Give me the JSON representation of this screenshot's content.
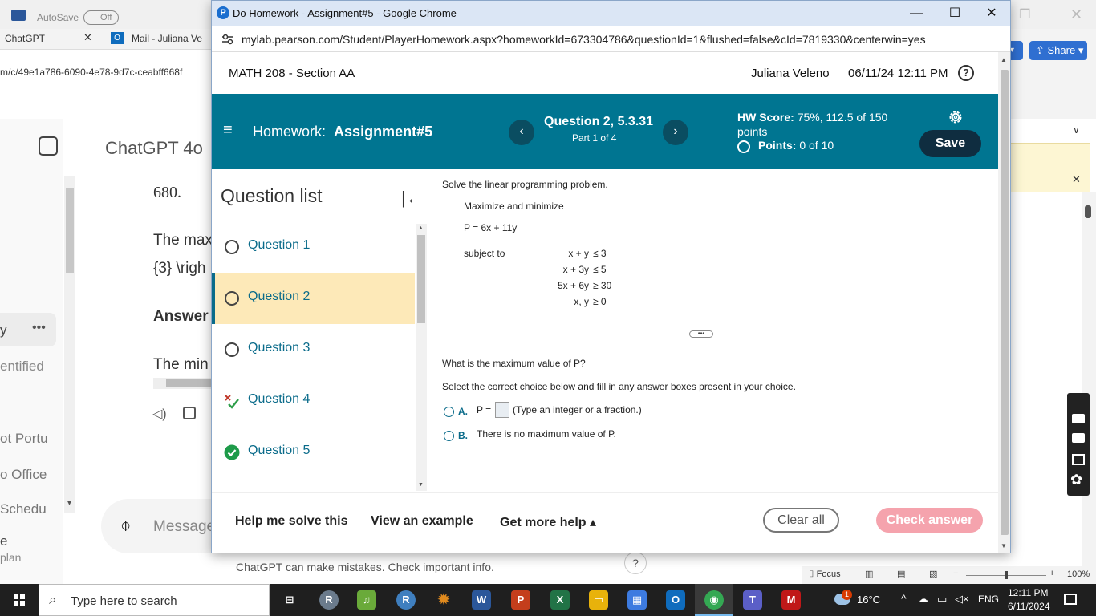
{
  "background": {
    "autosave_label": "AutoSave",
    "autosave_state": "Off",
    "tabs": [
      {
        "label": "ChatGPT"
      },
      {
        "label": "Mail - Juliana Ve"
      }
    ],
    "url_fragment": "m/c/49e1a786-6090-4e78-9d7c-ceabff668f",
    "share_label": "Share",
    "chatgpt": {
      "model_title": "ChatGPT 4o",
      "lines": [
        "680.",
        "The max",
        "{3} \\righ",
        "Answer",
        "The min"
      ],
      "side_items": [
        "y",
        "entified",
        "ot Portu",
        "o Office",
        "Schedu",
        "e",
        "plan"
      ],
      "message_placeholder": "Message",
      "footer_note": "ChatGPT can make mistakes. Check important info.",
      "help_symbol": "?"
    },
    "word_status": {
      "focus_label": "Focus",
      "zoom": "100%"
    }
  },
  "taskbar": {
    "search_placeholder": "Type here to search",
    "apps": [
      {
        "name": "task-view",
        "glyph": "⊟",
        "color": "#1f1f1f"
      },
      {
        "name": "app-r-gray",
        "glyph": "R",
        "color": "#6b7b8c"
      },
      {
        "name": "app-green",
        "glyph": "♫",
        "color": "#6aaa3a"
      },
      {
        "name": "app-r",
        "glyph": "R",
        "color": "#3f7fbf"
      },
      {
        "name": "app-sun",
        "glyph": "✹",
        "color": "#e08a1e"
      },
      {
        "name": "word",
        "glyph": "W",
        "color": "#2b579a"
      },
      {
        "name": "powerpoint",
        "glyph": "P",
        "color": "#c43e1c"
      },
      {
        "name": "excel",
        "glyph": "X",
        "color": "#217346"
      },
      {
        "name": "file-explorer",
        "glyph": "▭",
        "color": "#e8b20b"
      },
      {
        "name": "store",
        "glyph": "▦",
        "color": "#3d7be0"
      },
      {
        "name": "outlook",
        "glyph": "O",
        "color": "#0f6cbd"
      },
      {
        "name": "chrome",
        "glyph": "◉",
        "color": "#34a853"
      },
      {
        "name": "teams",
        "glyph": "T",
        "color": "#5b5fc7"
      },
      {
        "name": "mcafee",
        "glyph": "M",
        "color": "#c01818"
      }
    ],
    "weather": "16°C",
    "language": "ENG",
    "time": "12:11 PM",
    "date": "6/11/2024",
    "notification_badge": "1"
  },
  "window": {
    "title": "Do Homework - Assignment#5 - Google Chrome",
    "url": "mylab.pearson.com/Student/PlayerHomework.aspx?homeworkId=673304786&questionId=1&flushed=false&cId=7819330&centerwin=yes",
    "logo_letter": "P"
  },
  "header": {
    "course": "MATH 208 - Section AA",
    "user": "Juliana Veleno",
    "datetime": "06/11/24 12:11 PM",
    "help_symbol": "?"
  },
  "hw_bar": {
    "homework_prefix": "Homework:",
    "assignment": "Assignment#5",
    "question_title": "Question 2, 5.3.31",
    "part": "Part 1 of 4",
    "score_label": "HW Score:",
    "score_value": "75%, 112.5 of 150",
    "score_unit": "points",
    "points_label": "Points:",
    "points_value": "0 of 10",
    "save_label": "Save",
    "prev_symbol": "‹",
    "next_symbol": "›"
  },
  "question_list": {
    "title": "Question list",
    "collapse_symbol": "|←",
    "items": [
      {
        "label": "Question 1",
        "status": "unanswered"
      },
      {
        "label": "Question 2",
        "status": "current"
      },
      {
        "label": "Question 3",
        "status": "unanswered"
      },
      {
        "label": "Question 4",
        "status": "partial"
      },
      {
        "label": "Question 5",
        "status": "correct"
      }
    ]
  },
  "problem": {
    "instruction": "Solve the linear programming problem.",
    "objective_intro": "Maximize and minimize",
    "objective": "P = 6x + 11y",
    "subject_to": "subject to",
    "constraints": [
      {
        "lhs": "x + y",
        "rel": "≤ 3"
      },
      {
        "lhs": "x + 3y",
        "rel": "≤ 5"
      },
      {
        "lhs": "5x + 6y",
        "rel": "≥ 30"
      },
      {
        "lhs": "x, y",
        "rel": "≥ 0"
      }
    ],
    "question": "What is the maximum value of P?",
    "directions": "Select the correct choice below and fill in any answer boxes present in your choice.",
    "choices": [
      {
        "letter": "A.",
        "text_before": "P =",
        "hint": "(Type an integer or a fraction.)"
      },
      {
        "letter": "B.",
        "text": "There is no maximum value of P."
      }
    ],
    "divider_symbol": "•••"
  },
  "bottom": {
    "help_solve": "Help me solve this",
    "view_example": "View an example",
    "more_help": "Get more help ▴",
    "clear_all": "Clear all",
    "check_answer": "Check answer"
  },
  "colors": {
    "hw_bar": "#007591",
    "save_button": "#0f2d40",
    "current_question": "#fde9b8",
    "check_answer": "#f5a3ad",
    "link_teal": "#0a6b8a"
  }
}
